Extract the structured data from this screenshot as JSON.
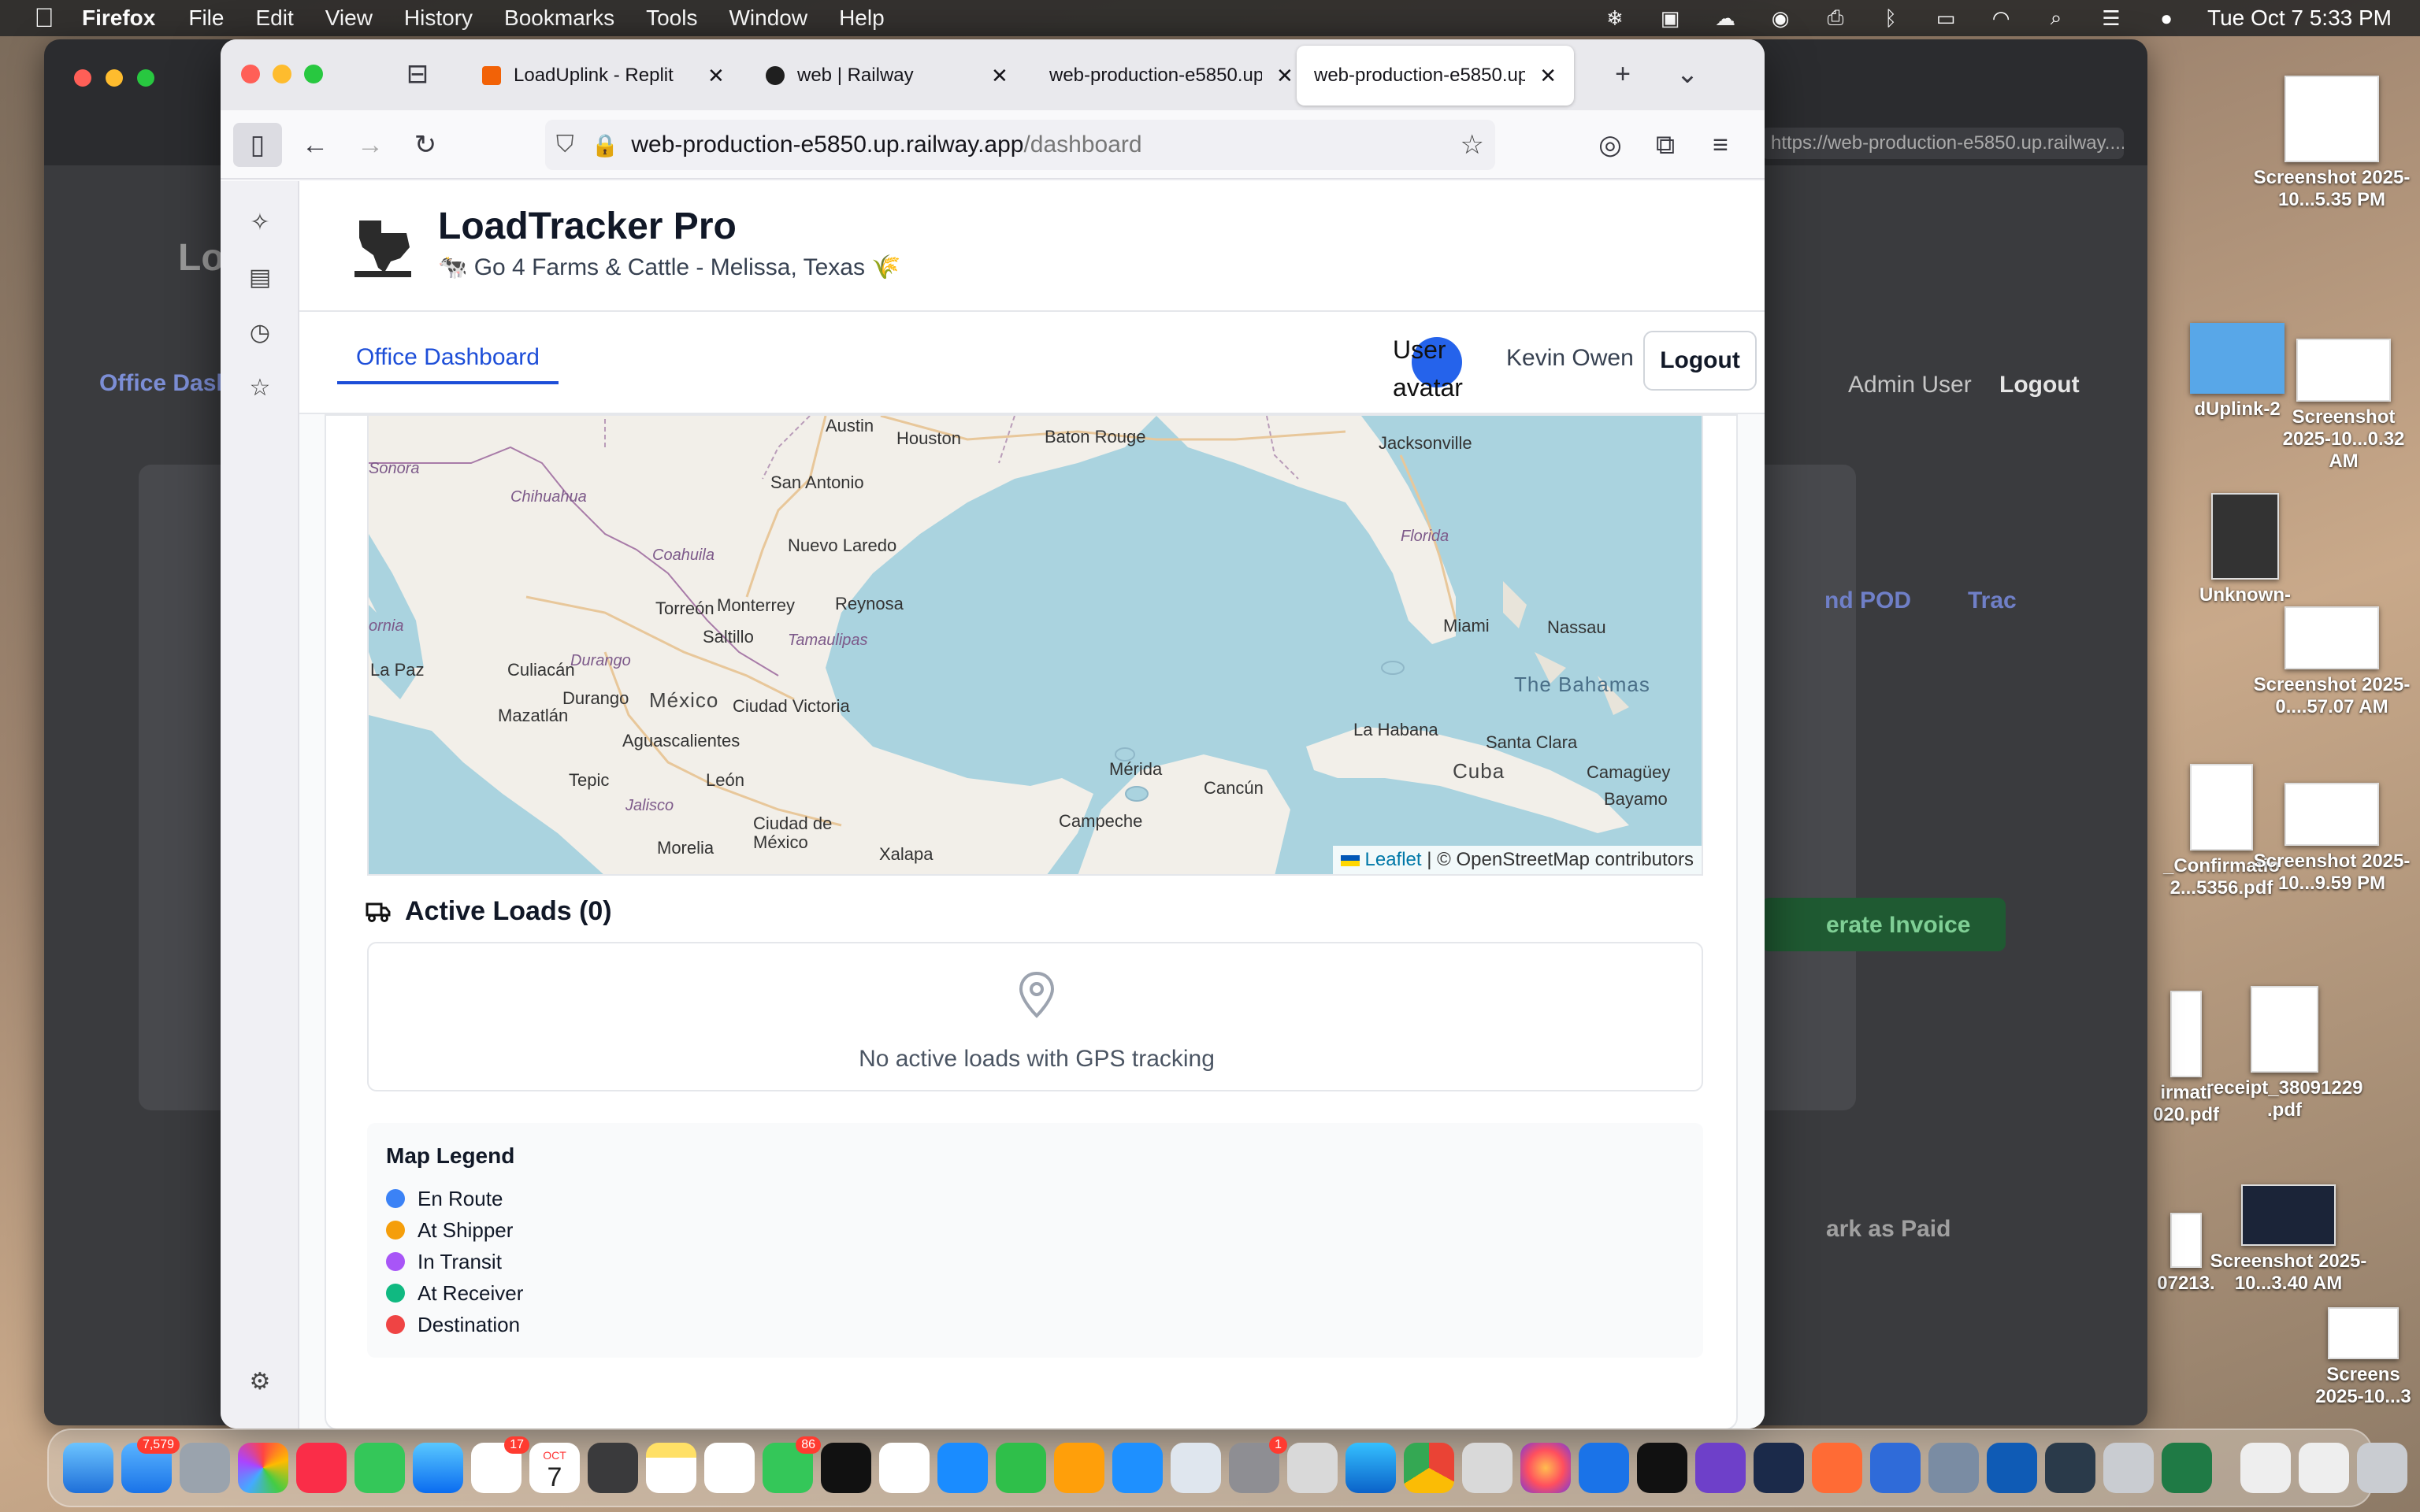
{
  "menubar": {
    "app_name": "Firefox",
    "menus": [
      "File",
      "Edit",
      "View",
      "History",
      "Bookmarks",
      "Tools",
      "Window",
      "Help"
    ],
    "clock": "Tue Oct 7  5:33 PM"
  },
  "browser": {
    "tabs": [
      {
        "title": "LoadUplink - Replit",
        "favicon_color": "#f26207"
      },
      {
        "title": "web | Railway",
        "favicon_color": "#1f1f1f"
      },
      {
        "title": "web-production-e5850.up",
        "favicon_color": ""
      },
      {
        "title": "web-production-e5850.up",
        "favicon_color": ""
      }
    ],
    "url_host": "web-production-e5850.up.railway.app",
    "url_path": "/dashboard"
  },
  "background_window": {
    "url": "https://web-production-e5850.up.railway....",
    "labels": [
      "Admin User",
      "Logout",
      "nd POD",
      "Trac",
      "erate Invoice",
      "ark as Paid",
      "Office Dash",
      "Lo"
    ]
  },
  "app": {
    "title": "LoadTracker Pro",
    "subtitle": "🐄 Go 4 Farms & Cattle - Melissa, Texas 🌾",
    "nav_tab": "Office Dashboard",
    "avatar_alt": "User avatar",
    "user_name": "Kevin Owen",
    "logout_label": "Logout"
  },
  "map": {
    "labels": {
      "austin": "Austin",
      "houston": "Houston",
      "baton_rouge": "Baton Rouge",
      "jacksonville": "Jacksonville",
      "san_antonio": "San Antonio",
      "sonora": "Sonora",
      "chihuahua": "Chihuahua",
      "coahuila": "Coahuila",
      "nuevo_laredo": "Nuevo Laredo",
      "florida": "Florida",
      "torreon": "Torreón",
      "monterrey": "Monterrey",
      "reynosa": "Reynosa",
      "saltillo": "Saltillo",
      "tamaulipas": "Tamaulipas",
      "miami": "Miami",
      "nassau": "Nassau",
      "ornia": "ornia",
      "la_paz": "La Paz",
      "culiacan": "Culiacán",
      "durango_state": "Durango",
      "the_bahamas": "The Bahamas",
      "durango": "Durango",
      "mexico": "México",
      "ciudad_victoria": "Ciudad Victoria",
      "mazatlan": "Mazatlán",
      "la_habana": "La Habana",
      "santa_clara": "Santa Clara",
      "aguascalientes": "Aguascalientes",
      "cuba": "Cuba",
      "camaguey": "Camagüey",
      "tepic": "Tepic",
      "leon": "León",
      "merida": "Mérida",
      "cancun": "Cancún",
      "bayamo": "Bayamo",
      "jalisco": "Jalisco",
      "ciudad_de_mexico": "Ciudad de México",
      "campeche": "Campeche",
      "morelia": "Morelia",
      "xalapa": "Xalapa"
    },
    "attribution_link": "Leaflet",
    "attribution_text": " | © OpenStreetMap contributors"
  },
  "active_loads": {
    "title": "Active Loads (0)",
    "empty_message": "No active loads with GPS tracking"
  },
  "legend": {
    "title": "Map Legend",
    "items": [
      {
        "label": "En Route",
        "color": "#3b82f6"
      },
      {
        "label": "At Shipper",
        "color": "#f59e0b"
      },
      {
        "label": "In Transit",
        "color": "#a855f7"
      },
      {
        "label": "At Receiver",
        "color": "#10b981"
      },
      {
        "label": "Destination",
        "color": "#ef4444"
      }
    ]
  },
  "desktop": {
    "items": [
      {
        "label": "Screenshot 2025-10...5.35 PM"
      },
      {
        "label": "dUplink-2"
      },
      {
        "label": "Screenshot 2025-10...0.32 AM"
      },
      {
        "label": "Unknown-"
      },
      {
        "label": "Screenshot 2025-0....57.07 AM"
      },
      {
        "label": "_Confirmatio 2...5356.pdf"
      },
      {
        "label": "Screenshot 2025-10...9.59 PM"
      },
      {
        "label": "receipt_38091229 .pdf"
      },
      {
        "label": "irmati 020.pdf"
      },
      {
        "label": "Screenshot 2025-10...3.40 AM"
      },
      {
        "label": "07213."
      },
      {
        "label": "Screens 2025-10...3"
      }
    ]
  },
  "dock": {
    "badges": {
      "mail": "7,579",
      "reminders": "17",
      "messages": "86",
      "settings": "1"
    },
    "calendar_month": "OCT",
    "calendar_day": "7"
  }
}
